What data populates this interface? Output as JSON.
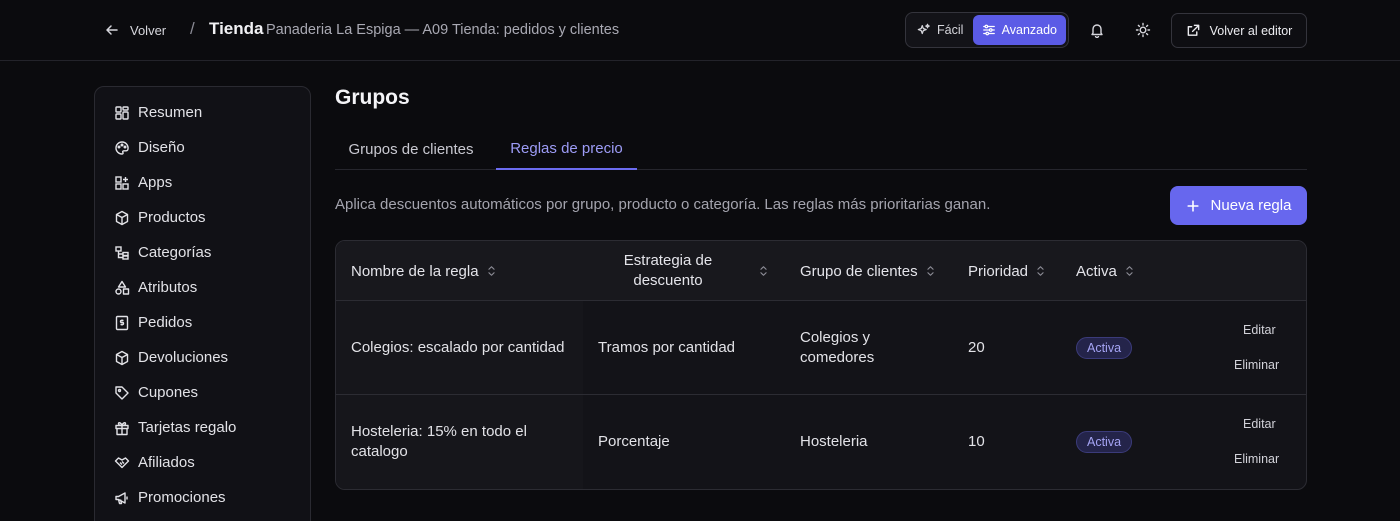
{
  "header": {
    "back_label": "Volver",
    "separator": "/",
    "section": "Tienda",
    "store_name": "Panaderia La Espiga — A09 Tienda: pedidos y clientes",
    "mode_easy": "Fácil",
    "mode_advanced": "Avanzado",
    "mode_selected": "Avanzado",
    "editor_label": "Volver al editor"
  },
  "sidebar": {
    "items": [
      {
        "label": "Resumen",
        "icon": "dashboard-icon"
      },
      {
        "label": "Diseño",
        "icon": "palette-icon"
      },
      {
        "label": "Apps",
        "icon": "apps-icon"
      },
      {
        "label": "Productos",
        "icon": "box-icon"
      },
      {
        "label": "Categorías",
        "icon": "category-icon"
      },
      {
        "label": "Atributos",
        "icon": "shapes-icon"
      },
      {
        "label": "Pedidos",
        "icon": "receipt-icon"
      },
      {
        "label": "Devoluciones",
        "icon": "box-return-icon"
      },
      {
        "label": "Cupones",
        "icon": "tag-icon"
      },
      {
        "label": "Tarjetas regalo",
        "icon": "gift-icon"
      },
      {
        "label": "Afiliados",
        "icon": "handshake-icon"
      },
      {
        "label": "Promociones",
        "icon": "megaphone-icon"
      }
    ]
  },
  "main": {
    "title": "Grupos",
    "tabs": [
      {
        "label": "Grupos de clientes",
        "active": false
      },
      {
        "label": "Reglas de precio",
        "active": true
      }
    ],
    "description": "Aplica descuentos automáticos por grupo, producto o categoría. Las reglas más prioritarias ganan.",
    "new_button": "Nueva regla"
  },
  "table": {
    "columns": [
      "Nombre de la regla",
      "Estrategia de descuento",
      "Grupo de clientes",
      "Prioridad",
      "Activa"
    ],
    "rows": [
      {
        "name": "Colegios: escalado por cantidad",
        "strategy": "Tramos por cantidad",
        "group": "Colegios y comedores",
        "priority": "20",
        "status": "Activa",
        "edit": "Editar",
        "delete": "Eliminar"
      },
      {
        "name": "Hosteleria: 15% en todo el catalogo",
        "strategy": "Porcentaje",
        "group": "Hosteleria",
        "priority": "10",
        "status": "Activa",
        "edit": "Editar",
        "delete": "Eliminar"
      }
    ]
  },
  "colors": {
    "accent": "#6767ee",
    "background": "#0b0b0e",
    "badge_text": "#a5a4f4"
  }
}
